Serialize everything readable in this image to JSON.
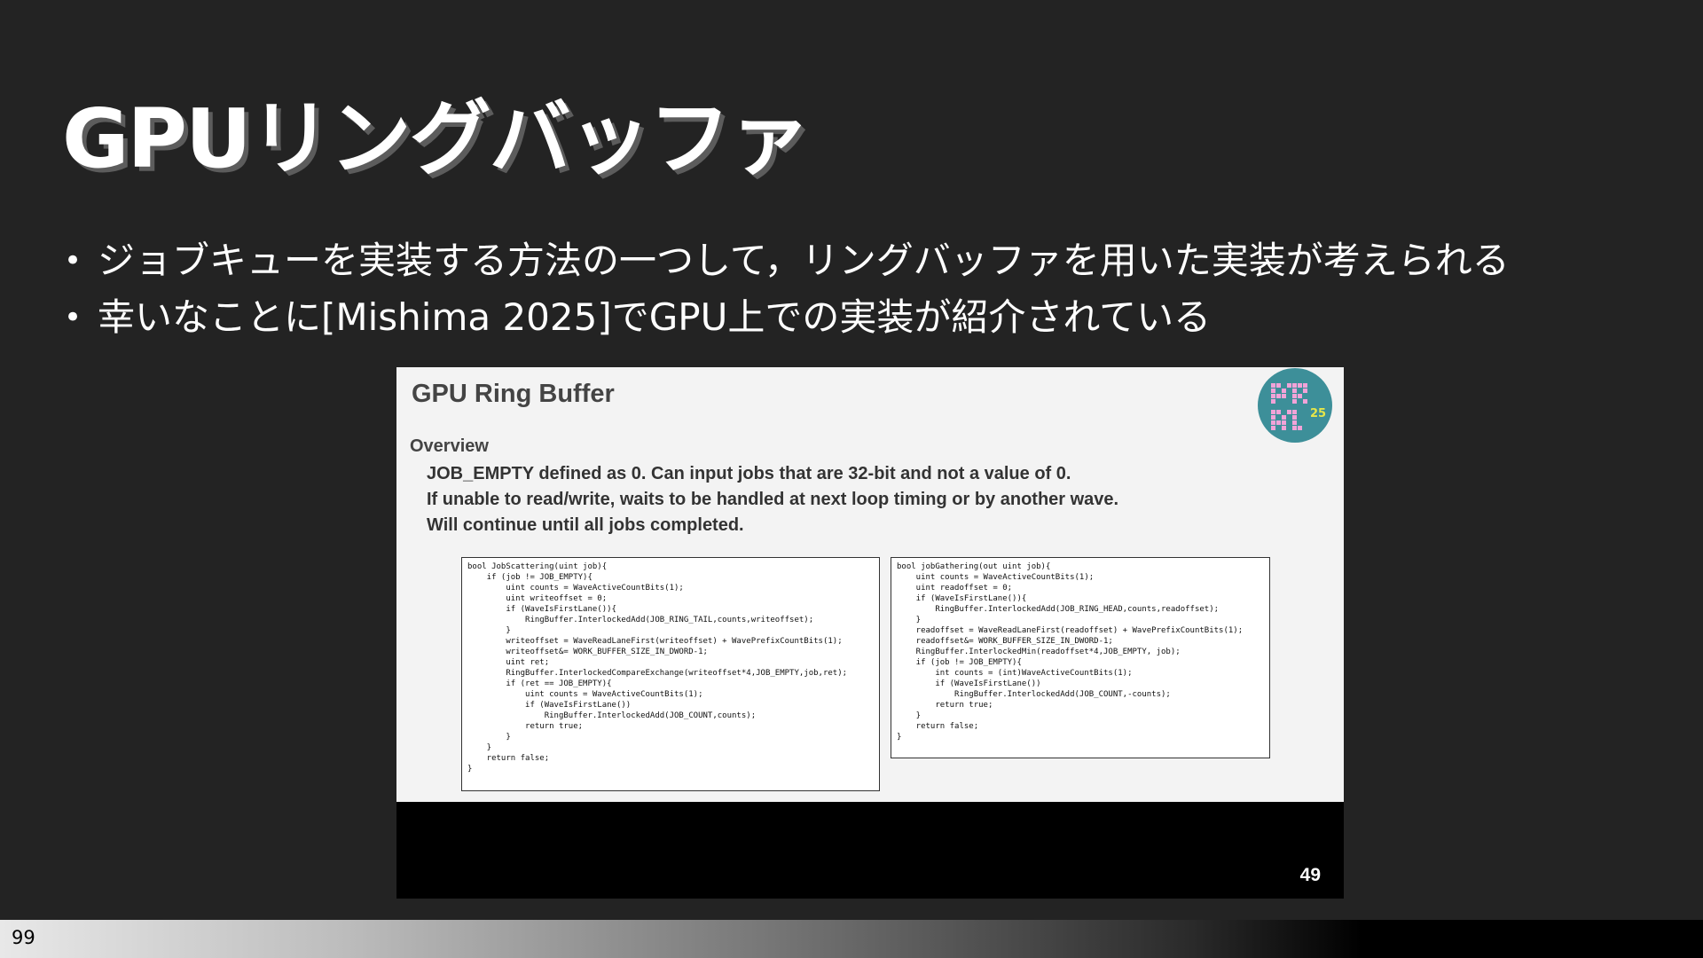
{
  "slide": {
    "title": "GPUリングバッファ",
    "bullets": [
      "ジョブキューを実装する方法の一つして，リングバッファを用いた実装が考えられる",
      "幸いなことに[Mishima 2025]でGPU上での実装が紹介されている"
    ],
    "page_number": "99"
  },
  "screenshot": {
    "title": "GPU Ring Buffer",
    "overview_heading": "Overview",
    "overview_lines": [
      "JOB_EMPTY defined as 0. Can input jobs that are 32-bit and not a value of 0.",
      "If unable to read/write, waits to be handled at next loop timing or by another wave.",
      "Will continue until all jobs completed."
    ],
    "page_number": "49",
    "logo_icon": "conference-logo-icon",
    "code_left": [
      "bool JobScattering(uint job){",
      "    if (job != JOB_EMPTY){",
      "        uint counts = WaveActiveCountBits(1);",
      "        uint writeoffset = 0;",
      "        if (WaveIsFirstLane()){",
      "            RingBuffer.InterlockedAdd(JOB_RING_TAIL,counts,writeoffset);",
      "        }",
      "        writeoffset = WaveReadLaneFirst(writeoffset) + WavePrefixCountBits(1);",
      "        writeoffset&= WORK_BUFFER_SIZE_IN_DWORD-1;",
      "        uint ret;",
      "        RingBuffer.InterlockedCompareExchange(writeoffset*4,JOB_EMPTY,job,ret);",
      "        if (ret == JOB_EMPTY){",
      "            uint counts = WaveActiveCountBits(1);",
      "            if (WaveIsFirstLane())",
      "                RingBuffer.InterlockedAdd(JOB_COUNT,counts);",
      "            return true;",
      "        }",
      "    }",
      "    return false;",
      "}"
    ],
    "code_right": [
      "bool jobGathering(out uint job){",
      "    uint counts = WaveActiveCountBits(1);",
      "    uint readoffset = 0;",
      "    if (WaveIsFirstLane()){",
      "        RingBuffer.InterlockedAdd(JOB_RING_HEAD,counts,readoffset);",
      "    }",
      "    readoffset = WaveReadLaneFirst(readoffset) + WavePrefixCountBits(1);",
      "    readoffset&= WORK_BUFFER_SIZE_IN_DWORD-1;",
      "    RingBuffer.InterlockedMin(readoffset*4,JOB_EMPTY, job);",
      "    if (job != JOB_EMPTY){",
      "        int counts = (int)WaveActiveCountBits(1);",
      "        if (WaveIsFirstLane())",
      "            RingBuffer.InterlockedAdd(JOB_COUNT,-counts);",
      "        return true;",
      "    }",
      "    return false;",
      "}"
    ]
  },
  "colors": {
    "background": "#232323",
    "title_shadow": "#5c5c5c",
    "logo_circle": "#3d8f99",
    "logo_dots": "#f2a3d8"
  }
}
